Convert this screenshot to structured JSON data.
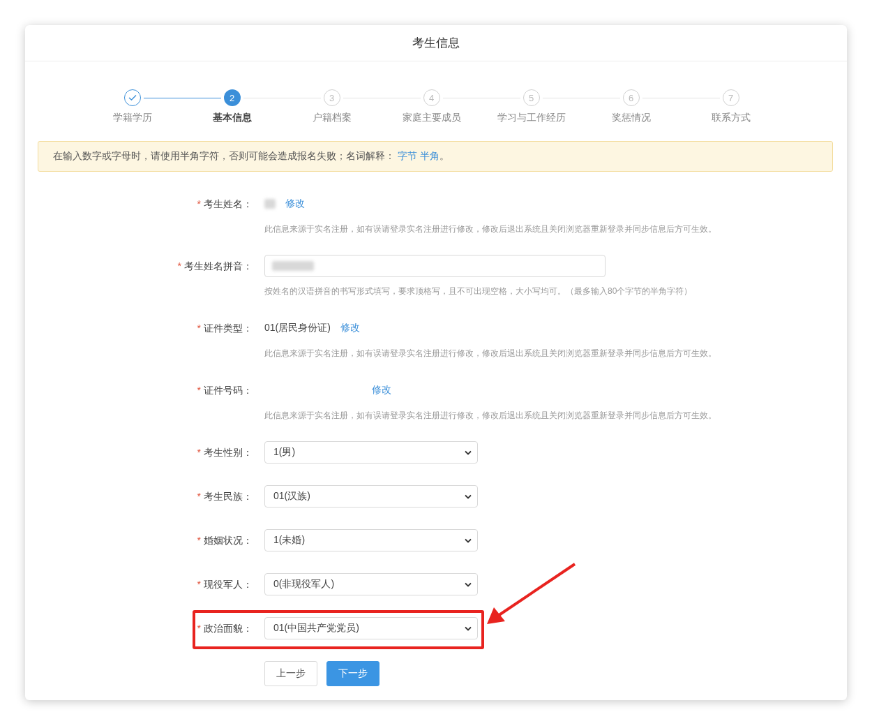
{
  "title": "考生信息",
  "steps": [
    {
      "label": "学籍学历",
      "done": true,
      "selected": false
    },
    {
      "number": "2",
      "label": "基本信息",
      "done": false,
      "selected": true
    },
    {
      "number": "3",
      "label": "户籍档案",
      "done": false,
      "selected": false
    },
    {
      "number": "4",
      "label": "家庭主要成员",
      "done": false,
      "selected": false
    },
    {
      "number": "5",
      "label": "学习与工作经历",
      "done": false,
      "selected": false
    },
    {
      "number": "6",
      "label": "奖惩情况",
      "done": false,
      "selected": false
    },
    {
      "number": "7",
      "label": "联系方式",
      "done": false,
      "selected": false
    }
  ],
  "notice": {
    "text": "在输入数字或字母时，请使用半角字符，否则可能会造成报名失败；名词解释：",
    "links": [
      "字节",
      "半角"
    ],
    "end": "。"
  },
  "fields": [
    {
      "kind": "text",
      "mark": "*",
      "label": "考生姓名：",
      "blurred": true,
      "link": "修改",
      "hint": "此信息来源于实名注册，如有误请登录实名注册进行修改，修改后退出系统且关闭浏览器重新登录并同步信息后方可生效。"
    },
    {
      "kind": "input",
      "mark": "*",
      "label": "考生姓名拼音：",
      "blurred": true,
      "hint": "按姓名的汉语拼音的书写形式填写，要求顶格写，且不可出现空格，大小写均可。（最多输入80个字节的半角字符）"
    },
    {
      "kind": "text",
      "mark": "*",
      "label": "证件类型：",
      "value": "01(居民身份证)",
      "link": "修改",
      "hint": "此信息来源于实名注册，如有误请登录实名注册进行修改，修改后退出系统且关闭浏览器重新登录并同步信息后方可生效。"
    },
    {
      "kind": "text",
      "mark": "*",
      "label": "证件号码：",
      "masked": true,
      "link": "修改",
      "hint": "此信息来源于实名注册，如有误请登录实名注册进行修改，修改后退出系统且关闭浏览器重新登录并同步信息后方可生效。"
    },
    {
      "kind": "select",
      "mark": "*",
      "label": "考生性别：",
      "value": "1(男)",
      "highlighted": false
    },
    {
      "kind": "select",
      "mark": "*",
      "label": "考生民族：",
      "value": "01(汉族)",
      "highlighted": false
    },
    {
      "kind": "select",
      "mark": "*",
      "label": "婚姻状况：",
      "value": "1(未婚)",
      "highlighted": false
    },
    {
      "kind": "select",
      "mark": "*",
      "label": "现役军人：",
      "value": "0(非现役军人)",
      "highlighted": false
    },
    {
      "kind": "select",
      "mark": "*",
      "label": "政治面貌：",
      "value": "01(中国共产党党员)",
      "highlighted": true
    }
  ],
  "buttons": [
    {
      "label": "上一步",
      "kind": "secondary"
    },
    {
      "label": "下一步",
      "kind": "primary"
    }
  ]
}
